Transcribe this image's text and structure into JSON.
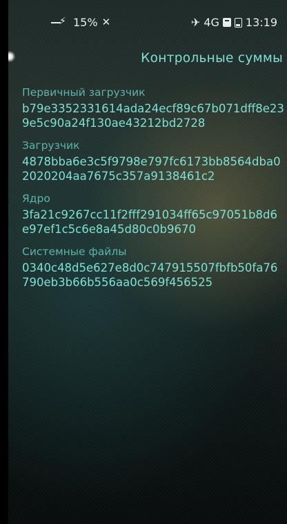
{
  "status_bar": {
    "battery_percent": "15%",
    "network": "4G",
    "time": "13:19"
  },
  "icons": {
    "charging": "charging-icon",
    "signal_off": "signal-off-icon",
    "airplane": "airplane-icon",
    "sim": "sim-icon",
    "battery": "battery-icon"
  },
  "page": {
    "title": "Контрольные суммы"
  },
  "checksums": [
    {
      "label": "Первичный загрузчик",
      "value": "b79e3352331614ada24ecf89c67b071dff8e239e5c90a24f130ae43212bd2728"
    },
    {
      "label": "Загрузчик",
      "value": "4878bba6e3c5f9798e797fc6173bb8564dba02020204aa7675c357a9138461c2"
    },
    {
      "label": "Ядро",
      "value": "3fa21c9267cc11f2fff291034ff65c97051b8d6e97ef1c5c6e8a45d80c0b9670"
    },
    {
      "label": "Системные файлы",
      "value": "0340c48d5e627e8d0c747915507fbfb50fa76790eb3b66b556aa0c569f456525"
    }
  ],
  "colors": {
    "accent": "#7fe0d4",
    "label": "#5fb3a9",
    "status_text": "#e8ecea"
  }
}
